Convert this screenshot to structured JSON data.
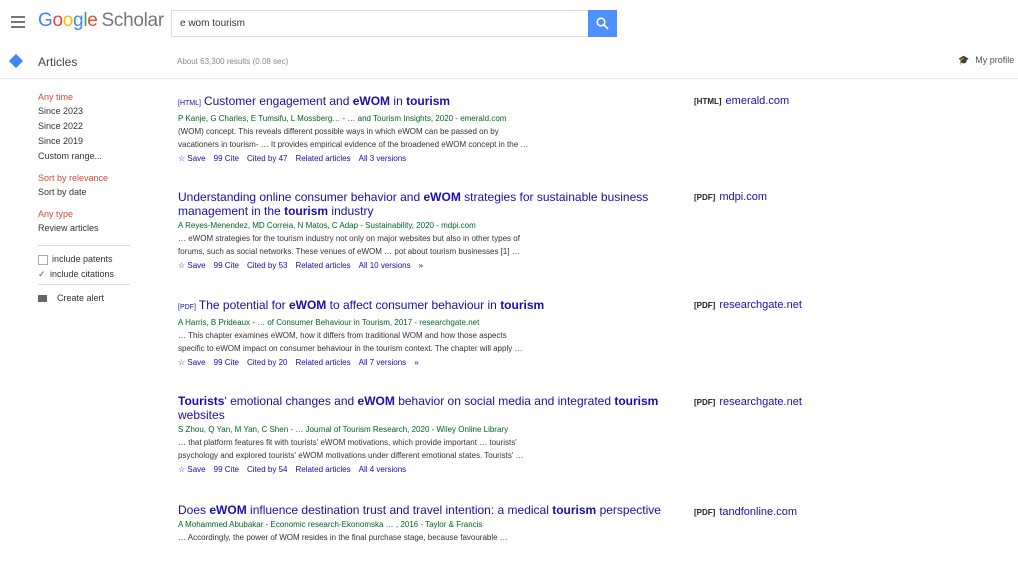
{
  "header": {
    "logo_parts": [
      "G",
      "o",
      "o",
      "g",
      "l",
      "e"
    ],
    "logo_product": "Scholar",
    "search_value": "e wom tourism"
  },
  "subbar": {
    "articles_label": "Articles",
    "result_count": "About 63,300 results (0.08 sec)",
    "my_profile": "My profile"
  },
  "sidebar": {
    "time_head": "Any time",
    "time_items": [
      "Since 2023",
      "Since 2022",
      "Since 2019",
      "Custom range..."
    ],
    "sort_head": "Sort by relevance",
    "sort_items": [
      "Sort by date"
    ],
    "type_head": "Any type",
    "type_items": [
      "Review articles"
    ],
    "include_patents": "include patents",
    "include_citations": "include citations",
    "create_alert": "Create alert"
  },
  "results": [
    {
      "tag": "[HTML]",
      "title_html": "Customer engagement and <b>eWOM</b> in <b>tourism</b>",
      "meta": "P Kanje, G Charles, E Tumsifu, L Mossberg… - … and Tourism Insights, 2020 - emerald.com",
      "snippet1": "(WOM) concept. This reveals different possible ways in which eWOM can be passed on by",
      "snippet2": "vacationers in tourism- … It provides empirical evidence of the broadened eWOM concept in the …",
      "links": [
        "☆ Save",
        "99 Cite",
        "Cited by 47",
        "Related articles",
        "All 3 versions"
      ],
      "side_fmt": "[HTML]",
      "side_site": "emerald.com"
    },
    {
      "tag": "",
      "title_html": "Understanding online consumer behavior and <b>eWOM</b> strategies for sustainable business management in the <b>tourism</b> industry",
      "meta": "A Reyes-Menendez, MD Correia, N Matos, C Adap - Sustainability, 2020 - mdpi.com",
      "snippet1": "… eWOM strategies for the tourism industry not only on major websites but also in other types of",
      "snippet2": "forums, such as social networks. These venues of eWOM … pot about tourism businesses [1] …",
      "links": [
        "☆ Save",
        "99 Cite",
        "Cited by 53",
        "Related articles",
        "All 10 versions",
        "»"
      ],
      "side_fmt": "[PDF]",
      "side_site": "mdpi.com"
    },
    {
      "tag": "[PDF]",
      "title_html": "The potential for <b>eWOM</b> to affect consumer behaviour in <b>tourism</b>",
      "meta": "A Harris, B Prideaux - … of Consumer Behaviour in Tourism, 2017 - researchgate.net",
      "snippet1": "… This chapter examines eWOM, how it differs from traditional WOM and how those aspects",
      "snippet2": "specific to eWOM impact on consumer behaviour in the tourism context. The chapter will apply …",
      "links": [
        "☆ Save",
        "99 Cite",
        "Cited by 20",
        "Related articles",
        "All 7 versions",
        "»"
      ],
      "side_fmt": "[PDF]",
      "side_site": "researchgate.net"
    },
    {
      "tag": "",
      "title_html": "<b>Tourists</b>' emotional changes and <b>eWOM</b> behavior on social media and integrated <b>tourism</b> websites",
      "meta": "S Zhou, Q Yan, M Yan, C Shen - … Journal of Tourism Research, 2020 - Wiley Online Library",
      "snippet1": "… that platform features fit with tourists' eWOM motivations, which provide important … tourists'",
      "snippet2": "psychology and explored tourists' eWOM motivations under different emotional states. Tourists' …",
      "links": [
        "☆ Save",
        "99 Cite",
        "Cited by 54",
        "Related articles",
        "All 4 versions"
      ],
      "side_fmt": "[PDF]",
      "side_site": "researchgate.net"
    },
    {
      "tag": "",
      "title_html": "Does <b>eWOM</b> influence destination trust and travel intention: a medical <b>tourism</b> perspective",
      "meta": "A Mohammed Abubakar - Economic research-Ekonomska … , 2016 - Taylor & Francis",
      "snippet1": "… Accordingly, the power of WOM resides in the final purchase stage, because favourable …",
      "snippet2": "",
      "links": [],
      "side_fmt": "[PDF]",
      "side_site": "tandfonline.com"
    }
  ]
}
